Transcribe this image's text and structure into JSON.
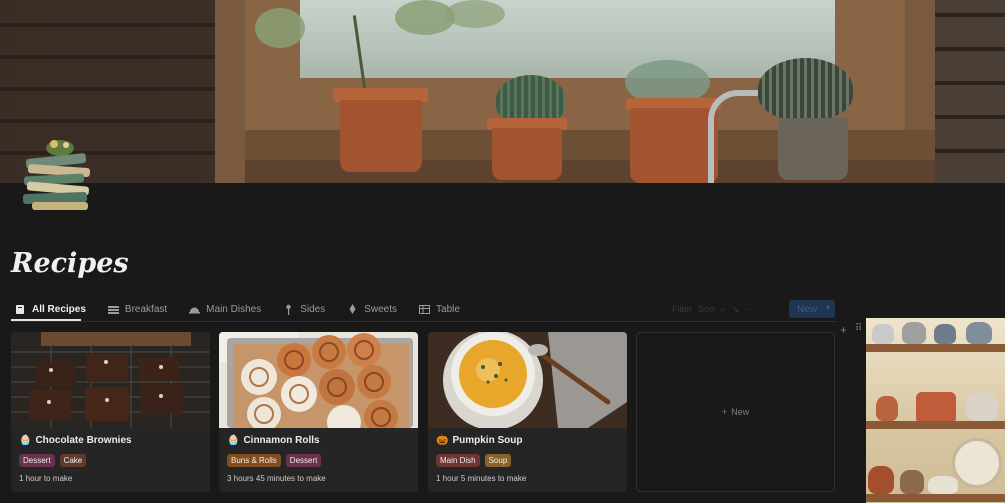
{
  "page": {
    "title": "Recipes"
  },
  "tabs": [
    {
      "label": "All Recipes",
      "icon": "book-icon",
      "active": true
    },
    {
      "label": "Breakfast",
      "icon": "rows-icon",
      "active": false
    },
    {
      "label": "Main Dishes",
      "icon": "cloche-icon",
      "active": false
    },
    {
      "label": "Sides",
      "icon": "pin-icon",
      "active": false
    },
    {
      "label": "Sweets",
      "icon": "lightbulb-icon",
      "active": false
    },
    {
      "label": "Table",
      "icon": "table-icon",
      "active": false
    }
  ],
  "toolbar": {
    "filter_label": "Filter",
    "sort_label": "Sort",
    "new_label": "New"
  },
  "cards": [
    {
      "name": "Chocolate Brownies",
      "emoji": "🧁",
      "tags": [
        {
          "label": "Dessert",
          "color": "#69314c"
        },
        {
          "label": "Cake",
          "color": "#603b2c"
        }
      ],
      "time": "1 hour to make"
    },
    {
      "name": "Cinnamon Rolls",
      "emoji": "🧁",
      "tags": [
        {
          "label": "Buns & Rolls",
          "color": "#854c1d"
        },
        {
          "label": "Dessert",
          "color": "#69314c"
        }
      ],
      "time": "3 hours 45 minutes to make"
    },
    {
      "name": "Pumpkin Soup",
      "emoji": "🎃",
      "tags": [
        {
          "label": "Main Dish",
          "color": "#6e3630"
        },
        {
          "label": "Soup",
          "color": "#89632a"
        }
      ],
      "time": "1 hour 5 minutes to make"
    }
  ],
  "new_card": {
    "label": "New"
  },
  "colors": {
    "background": "#191919",
    "card": "#252525",
    "accent": "#1e3553"
  }
}
